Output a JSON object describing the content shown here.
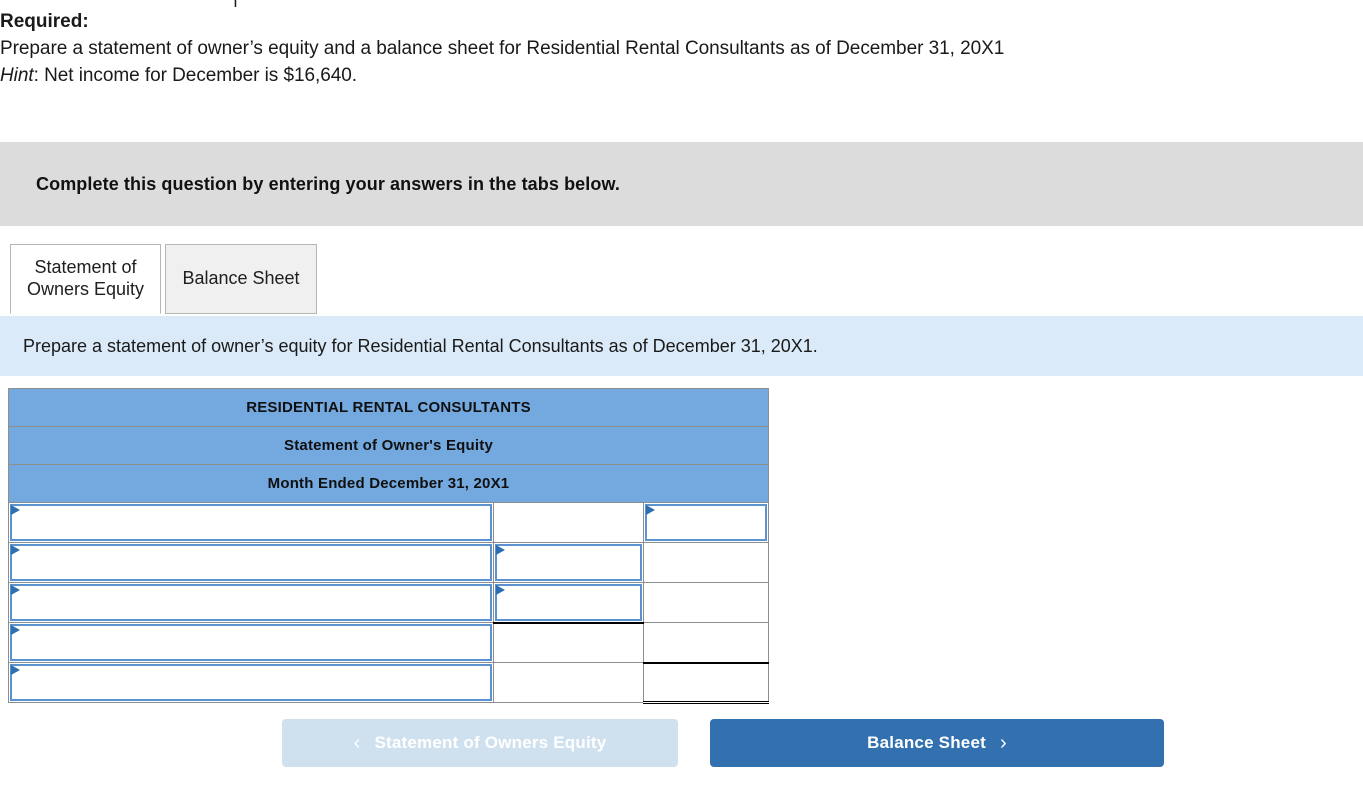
{
  "clipped_top_fragment": "|",
  "required": {
    "label": "Required:",
    "line1": "Prepare a statement of owner’s equity and a balance sheet for Residential Rental Consultants as of December 31, 20X1",
    "hint_label": "Hint",
    "hint_sep": ": ",
    "hint_text": "Net income for December is $16,640."
  },
  "banner": {
    "text": "Complete this question by entering your answers in the tabs below."
  },
  "tabs": [
    {
      "id": "statement-of-owners-equity",
      "label": "Statement of Owners Equity",
      "line1": "Statement of",
      "line2": "Owners Equity",
      "active": true
    },
    {
      "id": "balance-sheet",
      "label": "Balance Sheet",
      "line1": "Balance Sheet",
      "line2": "",
      "active": false
    }
  ],
  "instruction": {
    "text": "Prepare a statement of owner’s equity for Residential Rental Consultants as of December 31, 20X1."
  },
  "worksheet": {
    "header_rows": [
      "RESIDENTIAL RENTAL CONSULTANTS",
      "Statement of Owner's Equity",
      "Month Ended December 31, 20X1"
    ],
    "column_count": 3,
    "rows": [
      {
        "cells": [
          {
            "input": true,
            "value": "",
            "marker": "triangle"
          },
          {
            "input": false,
            "value": ""
          },
          {
            "input": true,
            "value": "",
            "marker": "triangle"
          }
        ]
      },
      {
        "cells": [
          {
            "input": true,
            "value": "",
            "marker": "triangle"
          },
          {
            "input": true,
            "value": "",
            "marker": "triangle"
          },
          {
            "input": false,
            "value": ""
          }
        ]
      },
      {
        "cells": [
          {
            "input": true,
            "value": "",
            "marker": "triangle"
          },
          {
            "input": true,
            "value": "",
            "marker": "triangle",
            "underline": "single"
          },
          {
            "input": false,
            "value": ""
          }
        ]
      },
      {
        "cells": [
          {
            "input": true,
            "value": "",
            "marker": "triangle"
          },
          {
            "input": false,
            "value": ""
          },
          {
            "input": false,
            "value": "",
            "underline": "single"
          }
        ]
      },
      {
        "cells": [
          {
            "input": true,
            "value": "",
            "marker": "triangle"
          },
          {
            "input": false,
            "value": ""
          },
          {
            "input": false,
            "value": "",
            "underline": "double"
          }
        ]
      }
    ]
  },
  "nav": {
    "prev_label": "Statement of Owners Equity",
    "prev_chevron": "‹",
    "next_label": "Balance Sheet",
    "next_chevron": "›"
  },
  "colors": {
    "header_blue": "#74a9e0",
    "instruction_blue": "#dbeaf8",
    "banner_gray": "#dcdcdc",
    "input_border_blue": "#5a93cf",
    "marker_blue": "#2e6fb0",
    "next_button_blue": "#3270b0",
    "prev_button_blue": "#cfe0ef"
  }
}
